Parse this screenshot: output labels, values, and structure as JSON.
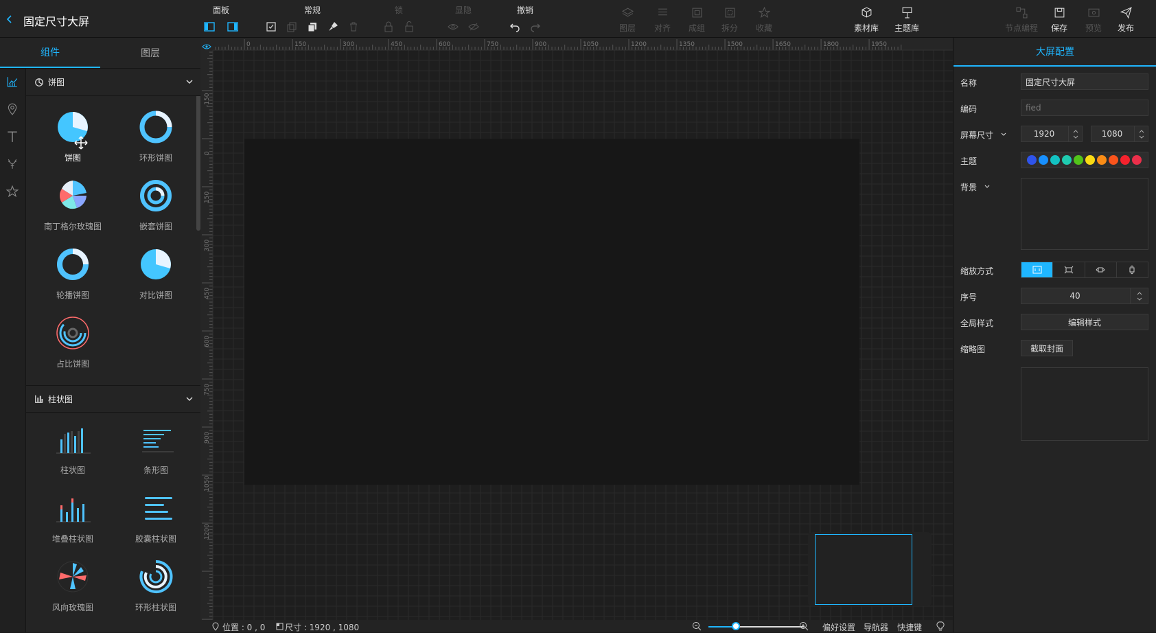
{
  "header": {
    "title": "固定尺寸大屏"
  },
  "toolbar": {
    "groups": {
      "panel": "面板",
      "common": "常规",
      "lock": "锁",
      "visibility": "显隐",
      "undo": "撤销"
    },
    "buttons": {
      "layer": "图层",
      "align": "对齐",
      "group": "成组",
      "split": "拆分",
      "favorite": "收藏",
      "materials": "素材库",
      "themes": "主题库",
      "node_program": "节点编程",
      "save": "保存",
      "preview": "预览",
      "publish": "发布"
    }
  },
  "left": {
    "tabs": [
      "组件",
      "图层"
    ],
    "categories": {
      "pie": "饼图",
      "bar": "柱状图"
    },
    "pie_items": [
      "饼图",
      "环形饼图",
      "南丁格尔玫瑰图",
      "嵌套饼图",
      "轮播饼图",
      "对比饼图",
      "占比饼图"
    ],
    "bar_items": [
      "柱状图",
      "条形图",
      "堆叠柱状图",
      "胶囊柱状图",
      "风向玫瑰图",
      "环形柱状图"
    ]
  },
  "ruler": {
    "x": [
      "0",
      "150",
      "300",
      "450",
      "600",
      "750",
      "900",
      "1050",
      "1200",
      "1350",
      "1500",
      "1650",
      "1800",
      "1950"
    ],
    "y": [
      "-150",
      "0",
      "150",
      "300",
      "450",
      "600",
      "750",
      "900",
      "1050",
      "1200"
    ]
  },
  "status": {
    "position": "位置 : 0 , 0",
    "size": "尺寸 : 1920 , 1080",
    "prefs": "偏好设置",
    "navigator": "导航器",
    "shortcuts": "快捷键"
  },
  "right": {
    "title": "大屏配置",
    "name_label": "名称",
    "name_value": "固定尺寸大屏",
    "code_label": "编码",
    "code_value": "fied",
    "size_label": "屏幕尺寸",
    "width": "1920",
    "height": "1080",
    "theme_label": "主题",
    "theme_colors": [
      "#2f54eb",
      "#1890ff",
      "#13c2c2",
      "#1fcbb0",
      "#52c41a",
      "#fadb14",
      "#fa8c16",
      "#fa541c",
      "#f5222d",
      "#eb2f4a"
    ],
    "bg_label": "背景",
    "scale_label": "缩放方式",
    "order_label": "序号",
    "order_value": "40",
    "style_label": "全局样式",
    "style_btn": "编辑样式",
    "thumb_label": "缩略图",
    "thumb_btn": "截取封面"
  }
}
